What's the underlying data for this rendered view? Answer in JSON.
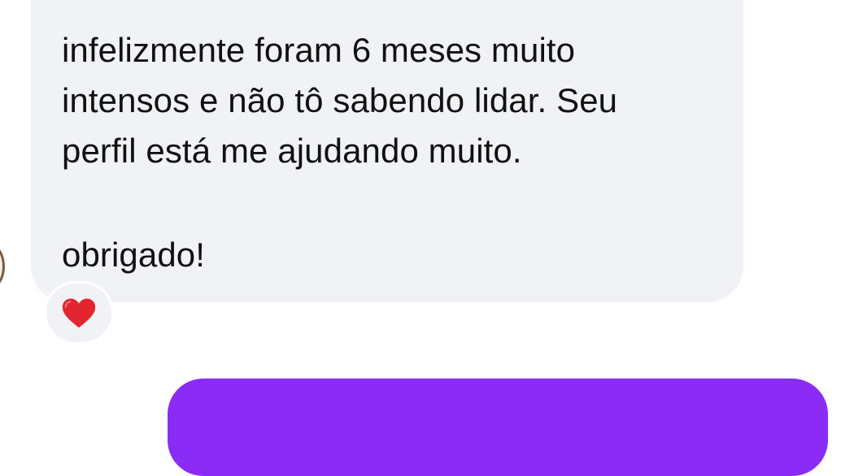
{
  "conversation": {
    "incoming_message": {
      "lines": [
        "infelizmente foram 6 meses muito",
        "intensos e não tô sabendo lidar. Seu",
        "perfil está me ajudando muito.",
        "obrigado!"
      ],
      "reaction_icon": "red-heart",
      "bubble_color": "#f1f2f6",
      "text_color": "#111111"
    },
    "outgoing_message": {
      "bubble_color": "#8a2cf5"
    }
  }
}
